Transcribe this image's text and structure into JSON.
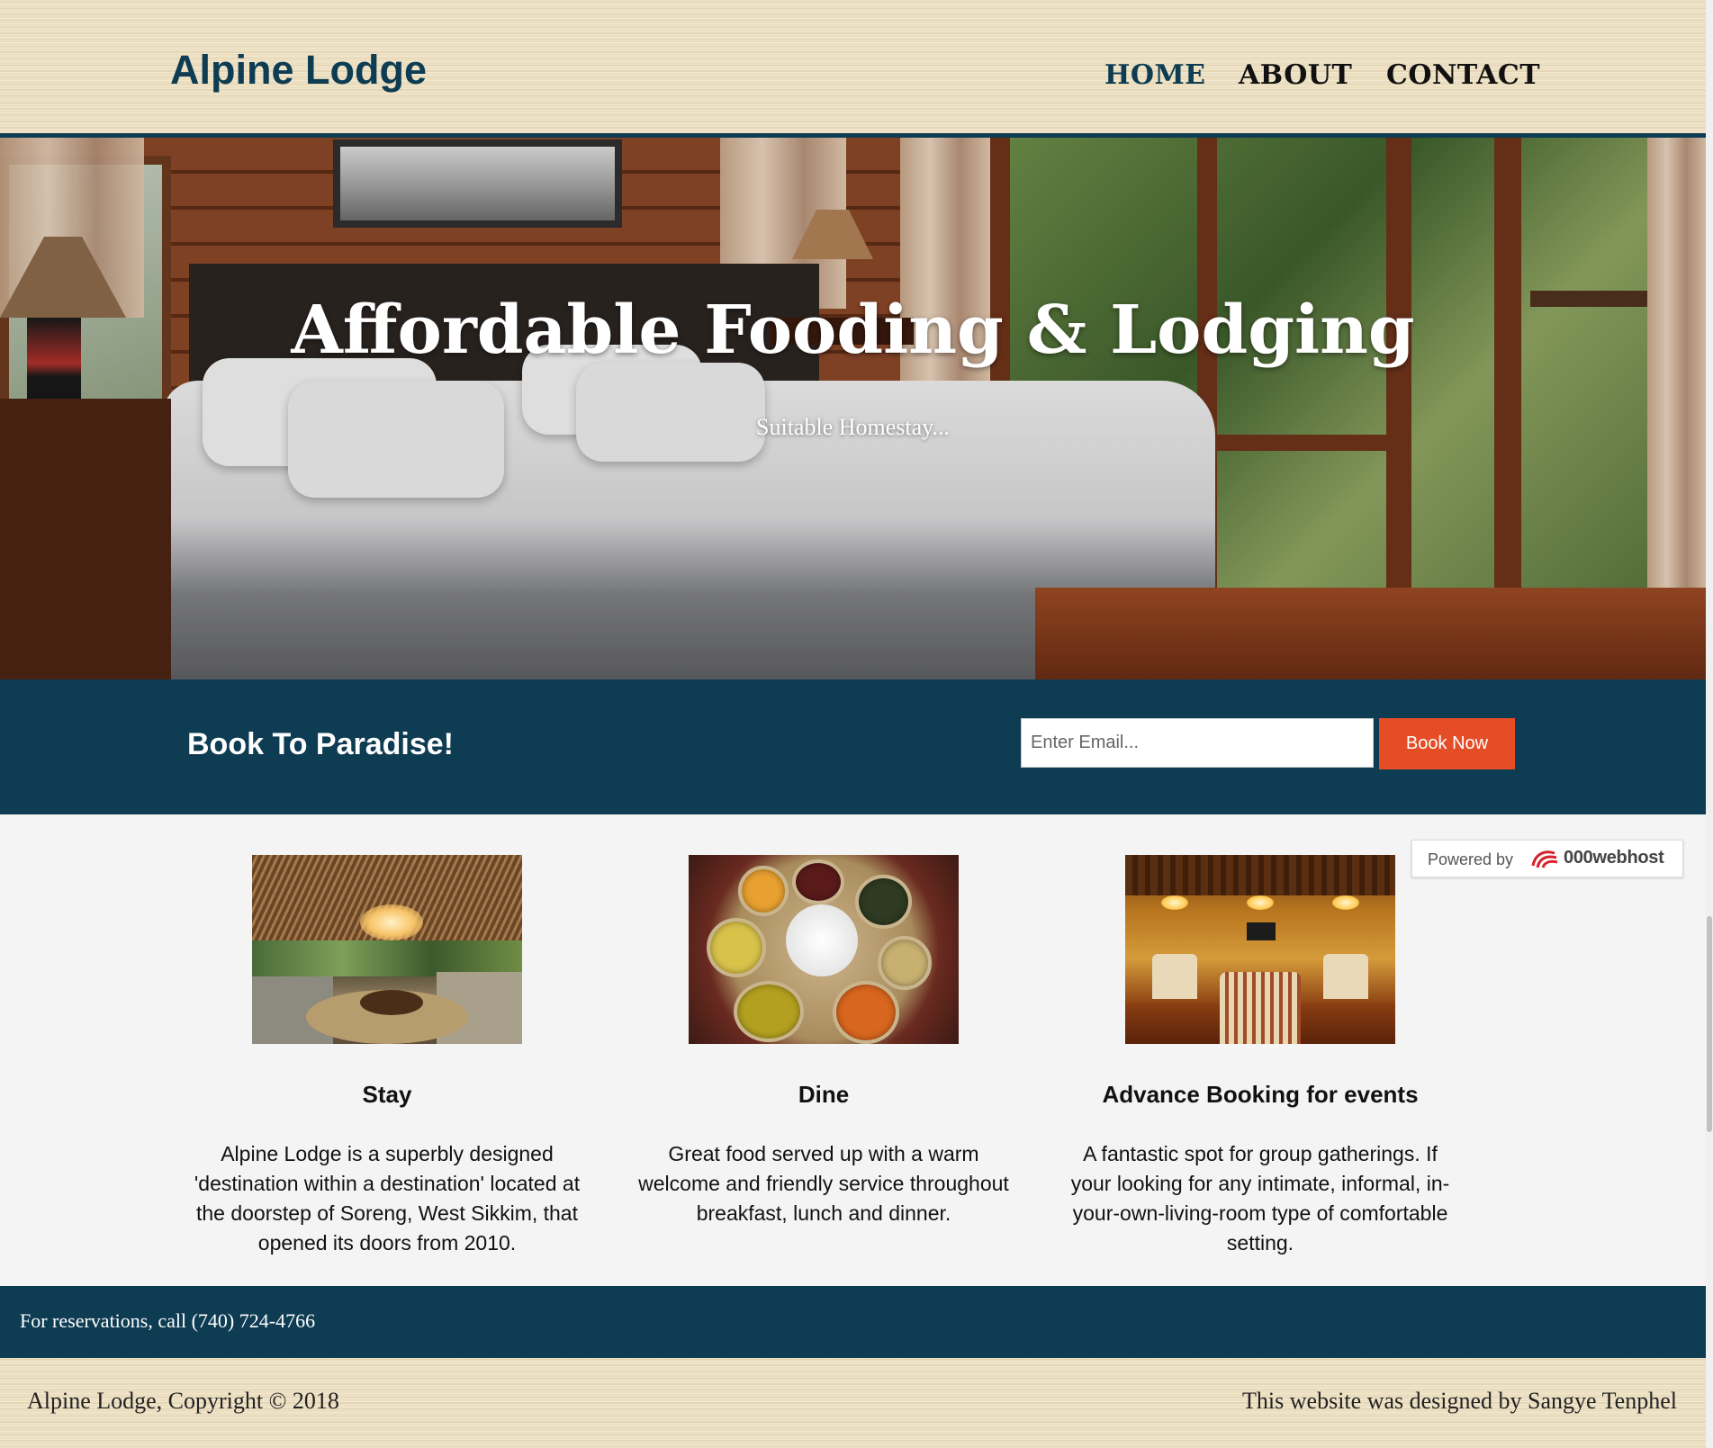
{
  "header": {
    "logo": "Alpine Lodge",
    "nav": [
      {
        "label": "HOME",
        "active": true
      },
      {
        "label": "ABOUT",
        "active": false
      },
      {
        "label": "CONTACT",
        "active": false
      }
    ]
  },
  "hero": {
    "title": "Affordable Fooding & Lodging",
    "subtitle": "Suitable Homestay..."
  },
  "newsletter": {
    "title": "Book To Paradise!",
    "email_placeholder": "Enter Email...",
    "button_label": "Book Now"
  },
  "boxes": [
    {
      "title": "Stay",
      "text": "Alpine Lodge is a superbly designed 'destination within a destination' located at the doorstep of Soreng, West Sikkim, that opened its doors from 2010."
    },
    {
      "title": "Dine",
      "text": "Great food served up with a warm welcome and friendly service throughout breakfast, lunch and dinner."
    },
    {
      "title": "Advance Booking for events",
      "text": "A fantastic spot for group gatherings. If your looking for any intimate, informal, in-your-own-living-room type of comfortable setting."
    }
  ],
  "badge": {
    "label": "Powered by",
    "brand": "000webhost"
  },
  "reservation": {
    "text": "For reservations, call (740) 724-4766"
  },
  "footer": {
    "copyright": "Alpine Lodge, Copyright © 2018",
    "designer": "This website was designed by Sangye Tenphel"
  },
  "colors": {
    "primary": "#0e3c53",
    "accent": "#e44d26",
    "background": "#f4f4f4",
    "wood": "#ecdfc0"
  }
}
